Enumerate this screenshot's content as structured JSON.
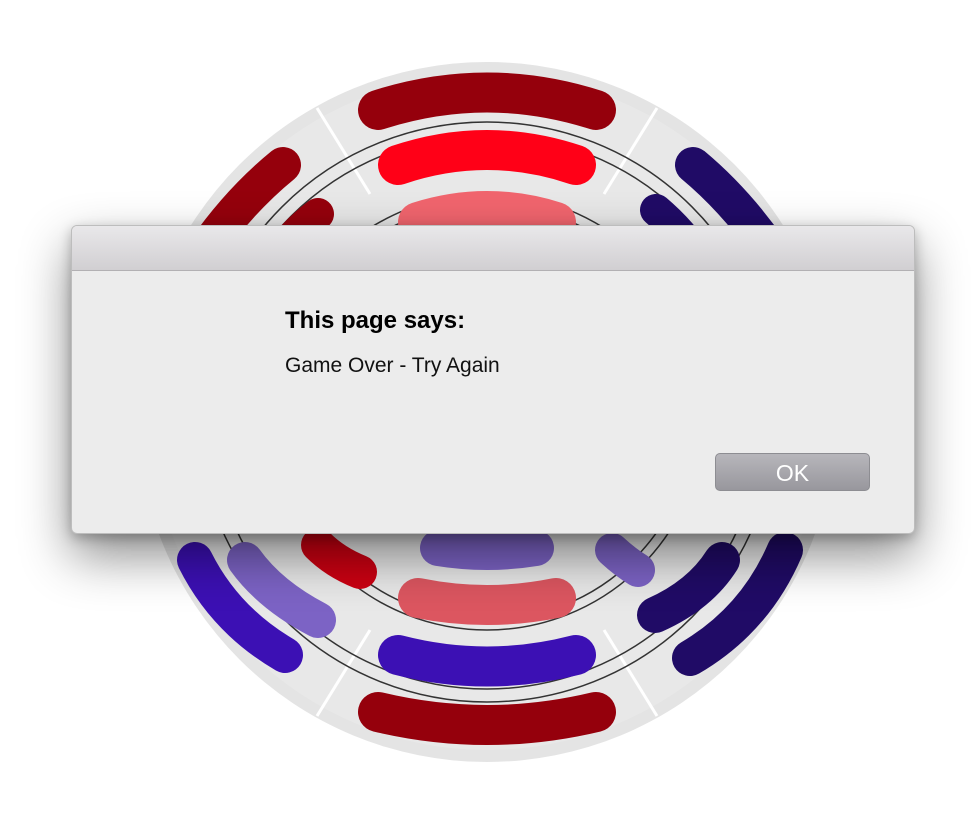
{
  "dialog": {
    "heading": "This page says:",
    "message": "Game Over - Try Again",
    "ok_label": "OK"
  },
  "game": {
    "ring_colors": {
      "dark_red": "#95000c",
      "red": "#ff0017",
      "light_red": "#f1656e",
      "dark_blue": "#200b66",
      "blue": "#3c10b4",
      "light_blue": "#7c63c5",
      "track": "#e6e6e6"
    }
  }
}
